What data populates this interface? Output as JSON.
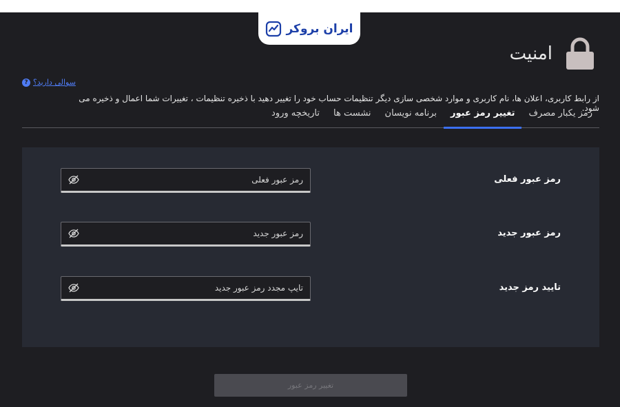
{
  "brand": {
    "name": "ایران بروکر"
  },
  "header": {
    "title": "امنیت"
  },
  "help": {
    "link_text": "سوالی دارید؟",
    "icon_glyph": "?"
  },
  "description": "از رابط کاربری، اعلان ها، نام کاربری و موارد شخصی سازی دیگر تنظیمات حساب خود را تغییر دهید با ذخیره تنظیمات ، تغییرات شما اعمال و ذخیره می شود.",
  "tabs": [
    {
      "label": "رمز یکبار مصرف",
      "active": false
    },
    {
      "label": "تغییر رمز عبور",
      "active": true
    },
    {
      "label": "برنامه نویسان",
      "active": false
    },
    {
      "label": "نشست ها",
      "active": false
    },
    {
      "label": "تاریخچه ورود",
      "active": false
    }
  ],
  "form": {
    "current_password": {
      "label": "رمز عبور فعلی",
      "placeholder": "رمز عبور فعلی"
    },
    "new_password": {
      "label": "رمز عبور جدید",
      "placeholder": "رمز عبور جدید"
    },
    "confirm_password": {
      "label": "تایید رمز جدید",
      "placeholder": "تایپ مجدد رمز عبور جدید"
    }
  },
  "submit": {
    "label": "تغییر رمز عبور",
    "enabled": false
  },
  "colors": {
    "background": "#1e1e22",
    "panel": "#272a33",
    "accent": "#3b6ff0",
    "link": "#4f7cf5",
    "brand": "#1c3fa8"
  },
  "icons": {
    "logo": "trend-chart-icon",
    "lock": "lock-icon",
    "help": "question-circle-icon",
    "visibility": "eye-off-icon"
  }
}
